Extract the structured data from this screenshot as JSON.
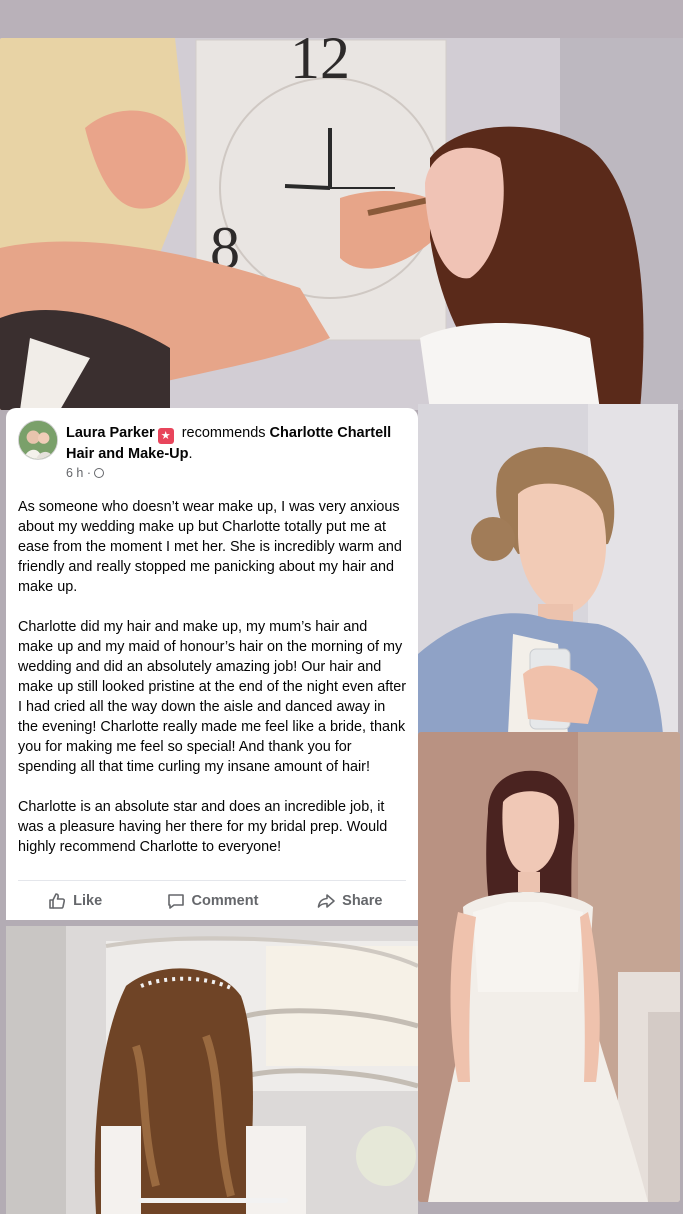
{
  "post": {
    "author": "Laura Parker",
    "recommends_text": "recommends",
    "business": "Charlotte Chartell Hair and Make-Up",
    "business_suffix": ".",
    "time": "6 h ·",
    "paragraphs": [
      "As someone who doesn’t wear make up, I was very anxious about my wedding make up but Charlotte totally put me at ease from the moment I met her. She is incredibly warm and friendly and really stopped me panicking about my hair and make up.",
      "Charlotte did my hair and make up, my mum’s hair and make up and my maid of honour’s hair on the morning of my wedding and did an absolutely amazing job! Our hair and make up still looked pristine at the end of the night even after I had cried all the way down the aisle and danced away in the evening! Charlotte really made me feel like a bride, thank you for making me feel so special! And thank you for spending all that time curling my insane amount of hair!",
      "Charlotte is an absolute star and does an incredible job, it was a pleasure having her there for my bridal prep. Would highly recommend Charlotte to everyone!"
    ],
    "actions": {
      "like": "Like",
      "comment": "Comment",
      "share": "Share"
    }
  },
  "icons": [
    "recommend-badge-icon",
    "globe-icon",
    "like-icon",
    "comment-icon",
    "share-icon"
  ],
  "colors": {
    "badge": "#e8455b",
    "meta_gray": "#65676b",
    "background": "#b3acb4"
  }
}
